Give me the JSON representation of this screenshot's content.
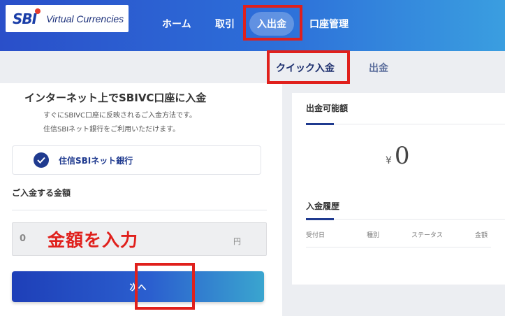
{
  "brand": {
    "mark": "SBI",
    "name": "Virtual Currencies"
  },
  "nav": {
    "home": "ホーム",
    "trade": "取引",
    "deposit": "入出金",
    "account": "口座管理"
  },
  "subnav": {
    "quick_deposit": "クイック入金",
    "withdraw": "出金"
  },
  "deposit": {
    "title": "インターネット上でSBIVC口座に入金",
    "desc1": "すぐにSBIVC口座に反映されるご入金方法です。",
    "desc2": "住信SBIネット銀行をご利用いただけます。",
    "bank": "住信SBIネット銀行",
    "amount_label": "ご入金する金額",
    "amount_value": "0",
    "amount_unit": "円",
    "annotation": "金額を入力",
    "next_button": "次へ"
  },
  "balance": {
    "title": "出金可能額",
    "currency": "¥",
    "value": "0"
  },
  "history": {
    "title": "入金履歴",
    "columns": [
      "受付日",
      "種別",
      "ステータス",
      "金額"
    ]
  },
  "colors": {
    "accent": "#1f3a8f",
    "annotation": "#e0201c"
  }
}
